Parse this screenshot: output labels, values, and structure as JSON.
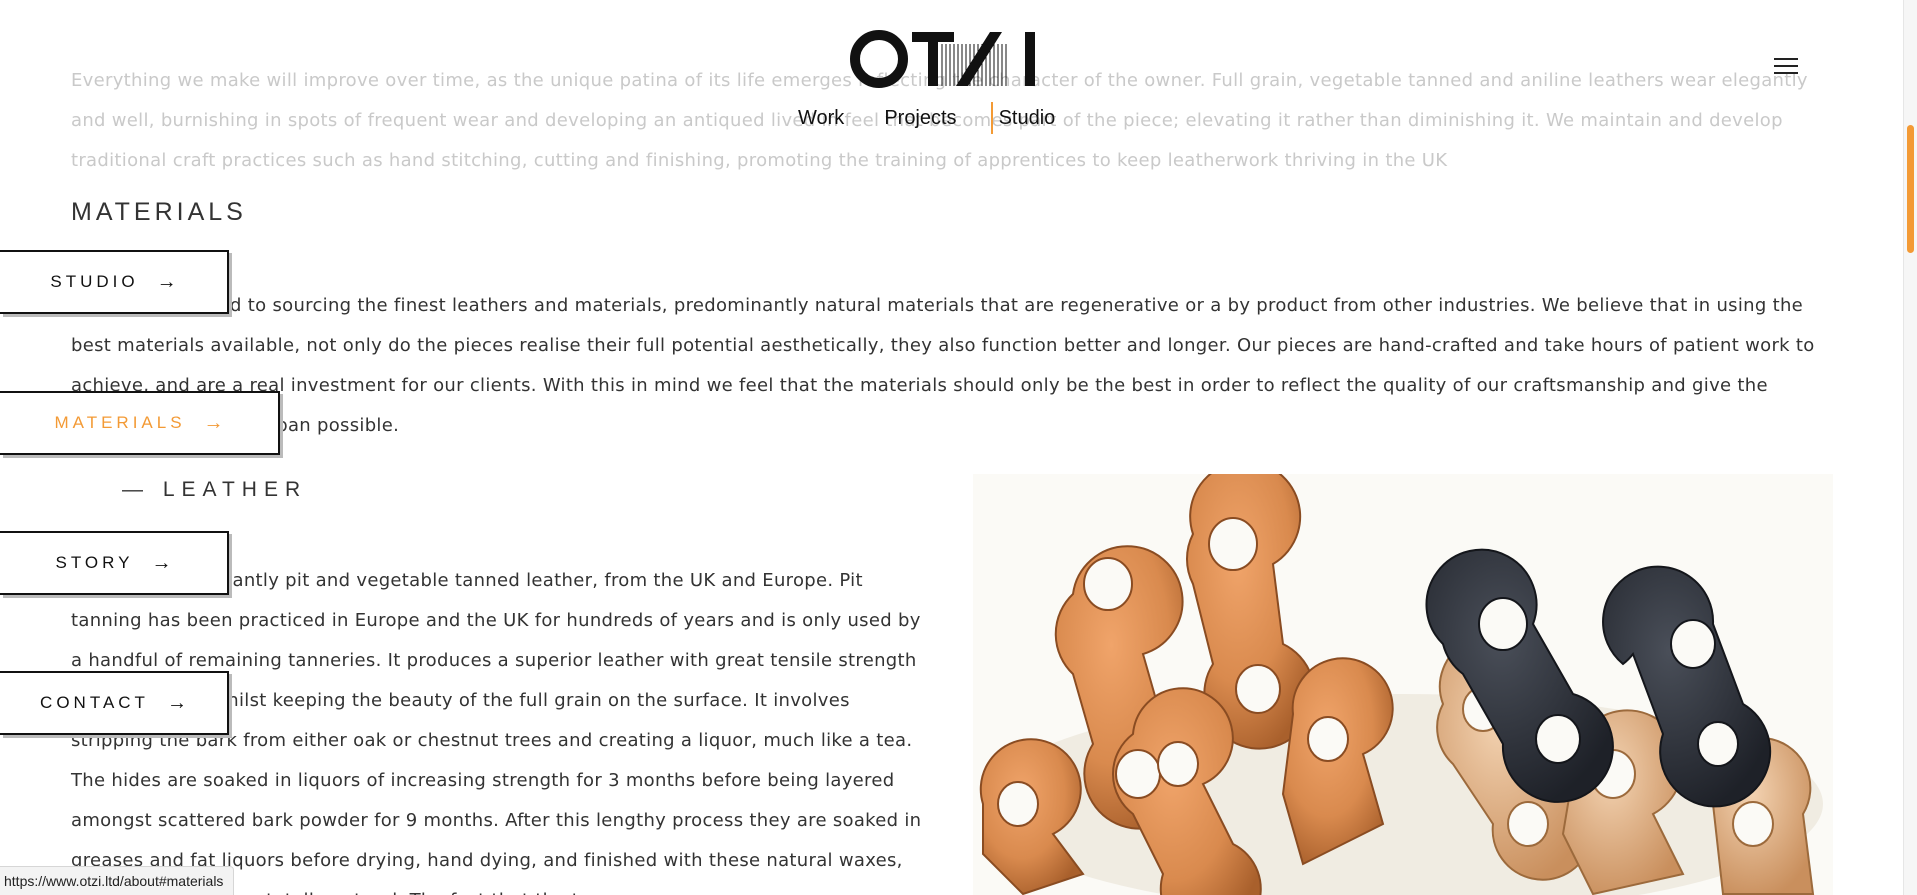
{
  "header": {
    "logo_text": "OTZI",
    "nav": {
      "work": "Work",
      "projects": "Projects",
      "studio": "Studio"
    },
    "accent_color": "#f39a35"
  },
  "intro_text": "Everything we make will improve over time, as the unique patina of its life emerges reflecting the character of the owner. Full grain, vegetable tanned and aniline leathers wear elegantly and well, burnishing in spots of frequent wear and developing an antiqued lived in feel that becomes part of the piece; elevating it rather than diminishing it. We maintain and develop traditional craft practices such as hand stitching, cutting and finishing, promoting the training of apprentices to keep leatherwork thriving in the UK",
  "materials": {
    "heading": "MATERIALS",
    "text": "We are committed to sourcing the finest leathers and materials, predominantly natural materials that are regenerative or a by product from other industries. We believe that in using the best materials available, not only do the pieces realise their full potential aesthetically, they also function better and longer. Our pieces are hand-crafted and take hours of patient work to achieve, and are a real investment for our clients. With this in mind we feel that the materials should only be the best in order to reflect the quality of our craftsmanship and give the piece the longest lifespan possible."
  },
  "leather": {
    "heading": "— LEATHER",
    "text": "We use predominantly pit and vegetable tanned leather, from the UK and Europe. Pit tanning has been practiced in Europe and the UK for hundreds of years and is only used by a handful of remaining tanneries. It produces a superior leather with great tensile strength and durability, whilst keeping the beauty of the full grain on the surface. It involves stripping the bark from either oak or chestnut trees and creating a liquor, much like a tea. The hides are soaked in liquors of increasing strength for 3 months before being layered amongst scattered bark powder for 9 months. After this lengthy process they are soaked in greases and fat liquors before drying, hand dying, and finished with these natural waxes, tallows, and fats are totally natural.  The fact that the tree"
  },
  "side_nav": [
    {
      "label": "STUDIO",
      "arrow": "→",
      "active": false
    },
    {
      "label": "MATERIALS",
      "arrow": "→",
      "active": true
    },
    {
      "label": "STORY",
      "arrow": "→",
      "active": false
    },
    {
      "label": "CONTACT",
      "arrow": "→",
      "active": false
    }
  ],
  "status_bar": {
    "url": "https://www.otzi.ltd/about#materials"
  },
  "icons": {
    "menu": "hamburger-menu-icon",
    "arrow": "right-arrow-icon"
  },
  "colors": {
    "leather_tan": "#d98a4e",
    "leather_dark": "#2c3038"
  }
}
